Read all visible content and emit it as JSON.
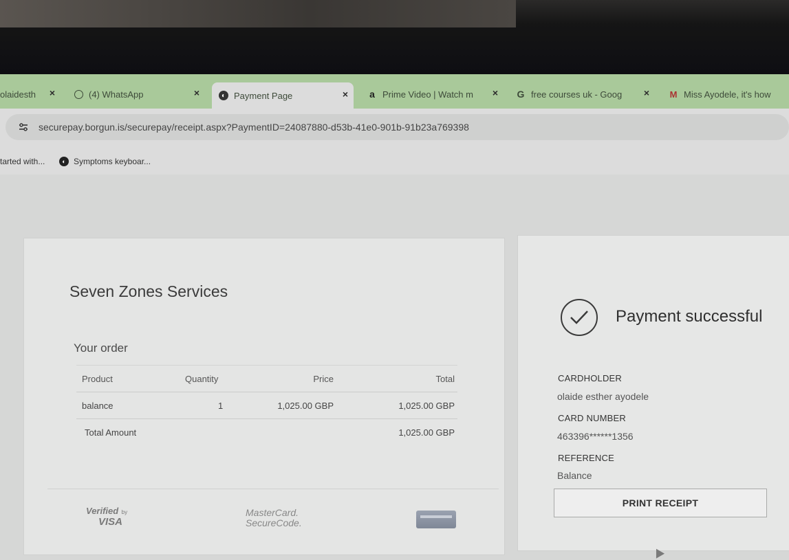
{
  "browser": {
    "tabs": [
      {
        "label": "olaidesth",
        "icon": "page-icon",
        "active": false
      },
      {
        "label": "(4) WhatsApp",
        "icon": "whatsapp-icon",
        "active": false
      },
      {
        "label": "Payment Page",
        "icon": "globe-icon",
        "active": true
      },
      {
        "label": "Prime Video | Watch m",
        "icon": "amazon-icon",
        "active": false
      },
      {
        "label": "free courses uk - Goog",
        "icon": "google-icon",
        "active": false
      },
      {
        "label": "Miss Ayodele, it's how",
        "icon": "gmail-icon",
        "active": false
      }
    ],
    "close_glyph": "×",
    "url": "securepay.borgun.is/securepay/receipt.aspx?PaymentID=24087880-d53b-41e0-901b-91b23a769398",
    "bookmarks": [
      {
        "label": "tarted with..."
      },
      {
        "label": "Symptoms keyboar..."
      }
    ]
  },
  "order": {
    "merchant": "Seven Zones Services",
    "title": "Your order",
    "headers": {
      "product": "Product",
      "quantity": "Quantity",
      "price": "Price",
      "total": "Total"
    },
    "items": [
      {
        "product": "balance",
        "quantity": "1",
        "price": "1,025.00 GBP",
        "total": "1,025.00 GBP"
      }
    ],
    "total_label": "Total Amount",
    "total_value": "1,025.00 GBP"
  },
  "logos": {
    "visa_verified": "Verified",
    "visa_by": "by",
    "visa_brand": "VISA",
    "mc_line1": "MasterCard.",
    "mc_line2": "SecureCode."
  },
  "payment": {
    "status": "Payment successful",
    "cardholder_label": "CARDHOLDER",
    "cardholder_value": "olaide esther ayodele",
    "card_number_label": "CARD NUMBER",
    "card_number_value": "463396******1356",
    "reference_label": "REFERENCE",
    "reference_value": "Balance",
    "print_button": "PRINT RECEIPT"
  }
}
